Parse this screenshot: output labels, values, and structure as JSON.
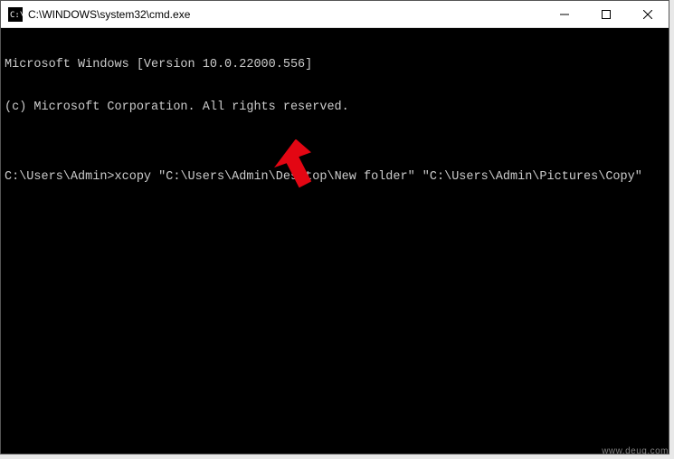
{
  "window": {
    "title": "C:\\WINDOWS\\system32\\cmd.exe"
  },
  "console": {
    "line1": "Microsoft Windows [Version 10.0.22000.556]",
    "line2": "(c) Microsoft Corporation. All rights reserved.",
    "blank": "",
    "prompt": "C:\\Users\\Admin>",
    "command": "xcopy \"C:\\Users\\Admin\\Desktop\\New folder\" \"C:\\Users\\Admin\\Pictures\\Copy\""
  },
  "annotation": {
    "arrow_color": "#e30613"
  },
  "watermark": "www.deuq.com"
}
